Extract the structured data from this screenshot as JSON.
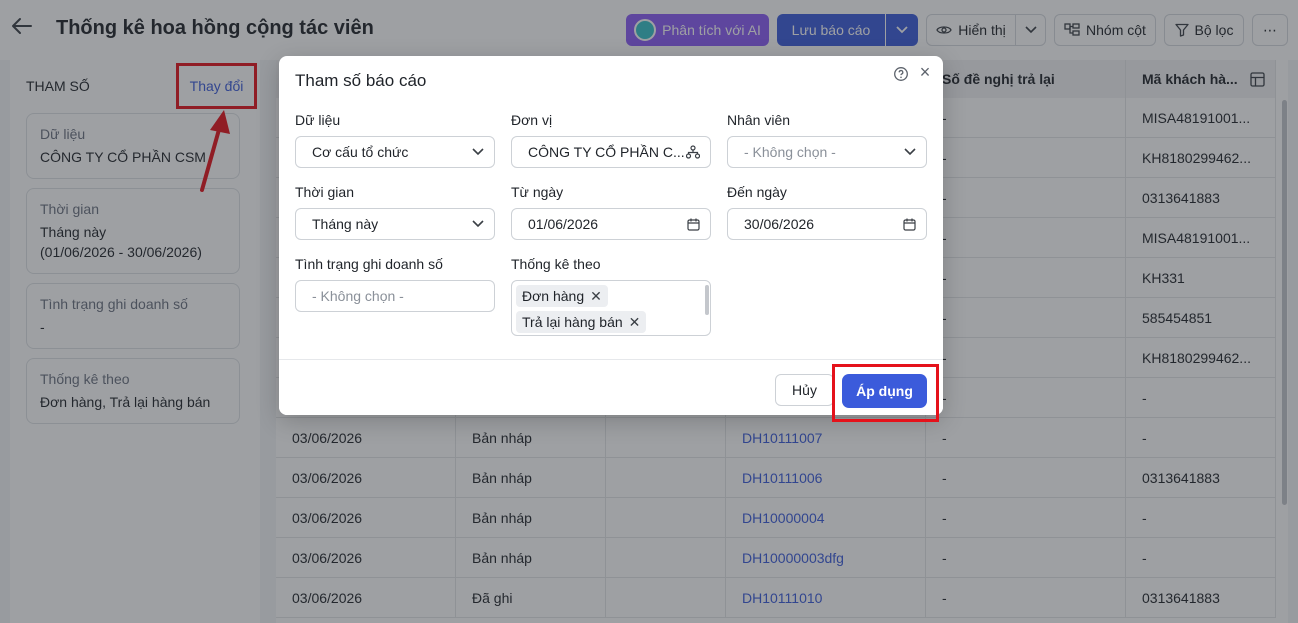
{
  "header": {
    "title": "Thống kê hoa hồng cộng tác viên",
    "ai_button": "Phân tích với AI",
    "save_button": "Lưu báo cáo",
    "view_button": "Hiển thị",
    "group_button": "Nhóm cột",
    "filter_button": "Bộ lọc",
    "more_button": "⋯"
  },
  "left_panel": {
    "heading": "THAM SỐ",
    "change_link": "Thay đổi",
    "cards": [
      {
        "label": "Dữ liệu",
        "value": "CÔNG TY CỔ PHẦN CSM"
      },
      {
        "label": "Thời gian",
        "value": "Tháng này",
        "value2": "(01/06/2026 - 30/06/2026)"
      },
      {
        "label": "Tình trạng ghi doanh số",
        "value": "-"
      },
      {
        "label": "Thống kê theo",
        "value": "Đơn hàng, Trả lại hàng bán"
      }
    ]
  },
  "table": {
    "headers": {
      "return_request": "Số đề nghị trả lại",
      "customer_code": "Mã khách hà..."
    },
    "top_rows": [
      {
        "rr": "-",
        "cust": "MISA48191001..."
      },
      {
        "rr": "-",
        "cust": "KH8180299462..."
      },
      {
        "rr": "-",
        "cust": "0313641883"
      },
      {
        "rr": "-",
        "cust": "MISA48191001..."
      },
      {
        "rr": "-",
        "cust": "KH331"
      },
      {
        "rr": "-",
        "cust": "585454851"
      },
      {
        "rr": "-",
        "cust": "KH8180299462..."
      },
      {
        "rr": "-",
        "cust": "-"
      }
    ],
    "rows": [
      {
        "date": "03/06/2026",
        "status": "Bản nháp",
        "order": "DH10111007",
        "rr": "-",
        "cust": "-"
      },
      {
        "date": "03/06/2026",
        "status": "Bản nháp",
        "order": "DH10111006",
        "rr": "-",
        "cust": "0313641883"
      },
      {
        "date": "03/06/2026",
        "status": "Bản nháp",
        "order": "DH10000004",
        "rr": "-",
        "cust": "-"
      },
      {
        "date": "03/06/2026",
        "status": "Bản nháp",
        "order": "DH10000003dfg",
        "rr": "-",
        "cust": "-"
      },
      {
        "date": "03/06/2026",
        "status": "Đã ghi",
        "order": "DH10111010",
        "rr": "-",
        "cust": "0313641883"
      }
    ]
  },
  "dialog": {
    "title": "Tham số báo cáo",
    "fields": {
      "data": {
        "label": "Dữ liệu",
        "value": "Cơ cấu tổ chức"
      },
      "unit": {
        "label": "Đơn vị",
        "value": "CÔNG TY CỔ PHẦN C..."
      },
      "employee": {
        "label": "Nhân viên",
        "placeholder": "- Không chọn -"
      },
      "time": {
        "label": "Thời gian",
        "value": "Tháng này"
      },
      "from_date": {
        "label": "Từ ngày",
        "value": "01/06/2026"
      },
      "to_date": {
        "label": "Đến ngày",
        "value": "30/06/2026"
      },
      "sales_status": {
        "label": "Tình trạng ghi doanh số",
        "placeholder": "- Không chọn -"
      },
      "stat_by": {
        "label": "Thống kê theo",
        "tags": [
          "Đơn hàng",
          "Trả lại hàng bán"
        ]
      }
    },
    "cancel_button": "Hủy",
    "apply_button": "Áp dụng"
  },
  "colors": {
    "primary": "#3b5bdb",
    "annotation": "#e5121b",
    "ai_button": "#8a5cf6"
  }
}
